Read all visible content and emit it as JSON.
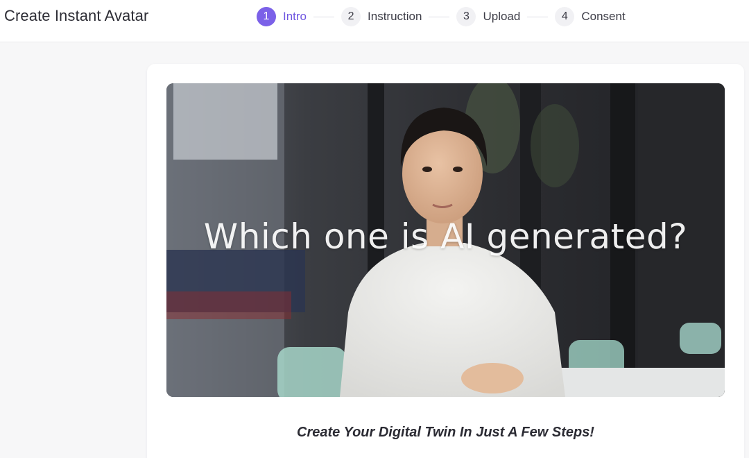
{
  "header": {
    "title": "Create Instant Avatar"
  },
  "stepper": {
    "steps": [
      {
        "number": "1",
        "label": "Intro",
        "active": true
      },
      {
        "number": "2",
        "label": "Instruction",
        "active": false
      },
      {
        "number": "3",
        "label": "Upload",
        "active": false
      },
      {
        "number": "4",
        "label": "Consent",
        "active": false
      }
    ],
    "accent_color": "#7b61e8"
  },
  "main": {
    "video_overlay_text": "Which one is AI generated?",
    "tagline": "Create Your Digital Twin In Just A Few Steps!"
  }
}
